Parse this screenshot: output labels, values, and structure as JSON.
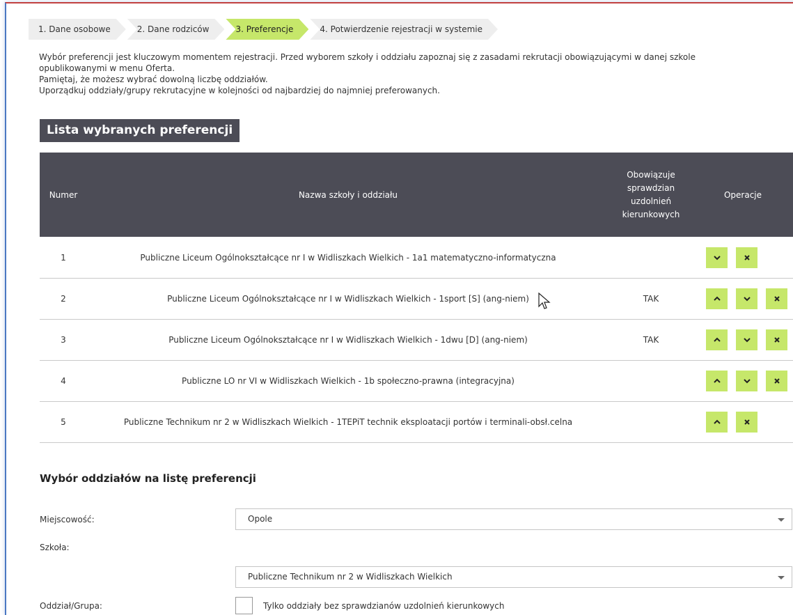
{
  "steps": [
    "1. Dane osobowe",
    "2. Dane rodziców",
    "3. Preferencje",
    "4. Potwierdzenie rejestracji w systemie"
  ],
  "intro": {
    "line1": "Wybór preferencji jest kluczowym momentem rejestracji. Przed wyborem szkoły i oddziału zapoznaj się z zasadami rekrutacji obowiązującymi w danej szkole",
    "line1b": "opublikowanymi w menu Oferta.",
    "line2": "Pamiętaj, że możesz wybrać dowolną liczbę oddziałów.",
    "line3": "Uporządkuj oddziały/grupy rekrutacyjne w kolejności od najbardziej do najmniej preferowanych."
  },
  "list_title": "Lista wybranych preferencji",
  "table": {
    "headers": {
      "num": "Numer",
      "name": "Nazwa szkoły i oddziału",
      "test_l1": "Obowiązuje",
      "test_l2": "sprawdzian",
      "test_l3": "uzdolnień",
      "test_l4": "kierunkowych",
      "ops": "Operacje"
    },
    "rows": [
      {
        "num": "1",
        "name": "Publiczne Liceum Ogólnokształcące nr I w Widliszkach Wielkich - 1a1 matematyczno-informatyczna",
        "test": ""
      },
      {
        "num": "2",
        "name": "Publiczne Liceum Ogólnokształcące nr I w Widliszkach Wielkich - 1sport [S] (ang-niem)",
        "test": "TAK"
      },
      {
        "num": "3",
        "name": "Publiczne Liceum Ogólnokształcące nr I w Widliszkach Wielkich - 1dwu [D] (ang-niem)",
        "test": "TAK"
      },
      {
        "num": "4",
        "name": "Publiczne LO nr VI w Widliszkach Wielkich - 1b społeczno-prawna (integracyjna)",
        "test": ""
      },
      {
        "num": "5",
        "name": "Publiczne Technikum nr 2 w Widliszkach Wielkich - 1TEPiT technik eksploatacji portów i terminali-obsł.celna",
        "test": ""
      }
    ]
  },
  "selection": {
    "title": "Wybór oddziałów na listę preferencji",
    "city_label": "Miejscowość:",
    "city_value": "Opole",
    "school_label": "Szkoła:",
    "school_value": "Publiczne Technikum nr 2 w Widliszkach Wielkich",
    "group_label": "Oddział/Grupa:",
    "checkbox_label": "Tylko oddziały bez sprawdzianów uzdolnień kierunkowych"
  },
  "colors": {
    "accent": "#c6e76a",
    "header": "#4c4c56"
  }
}
